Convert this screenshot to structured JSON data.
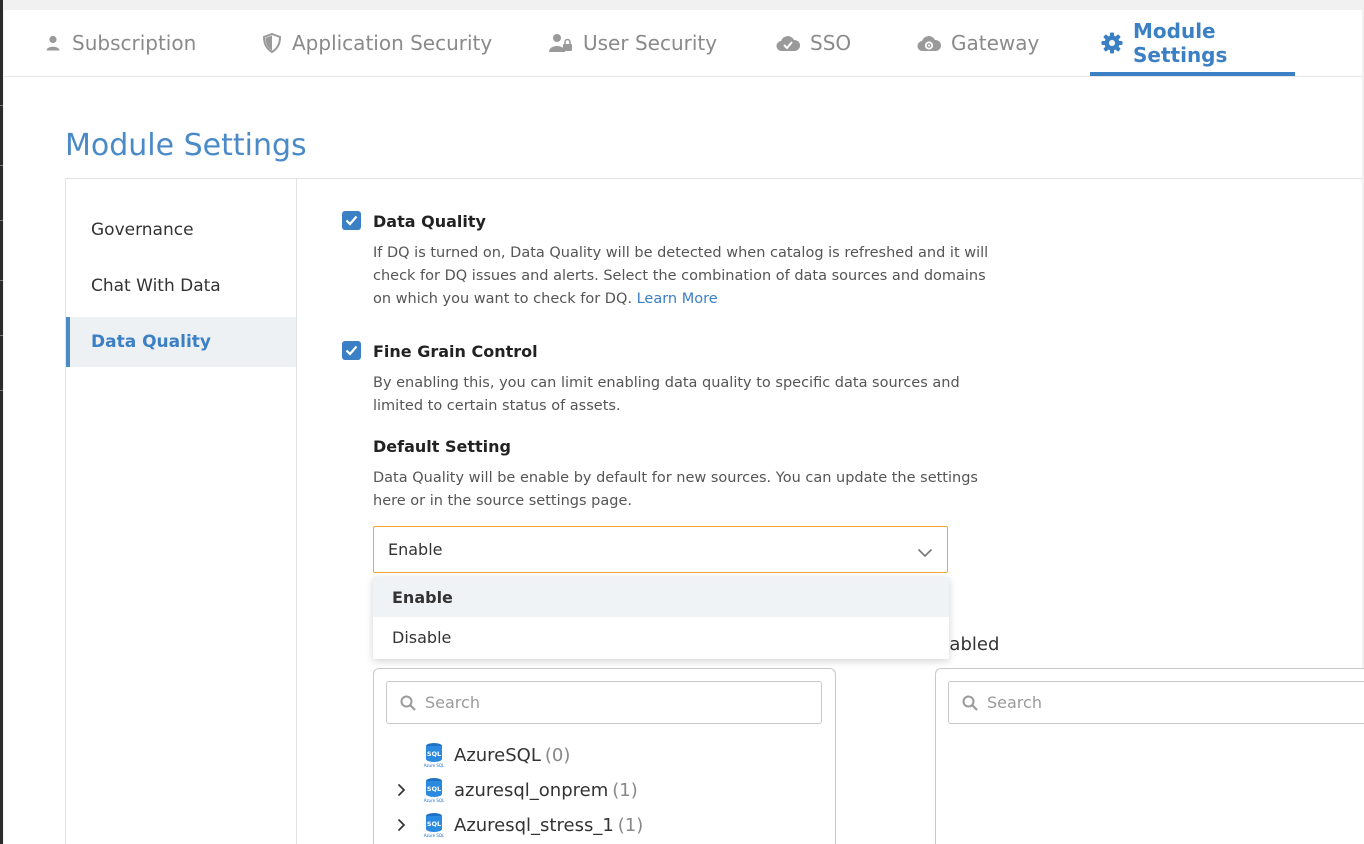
{
  "nav": {
    "tabs": [
      {
        "label": "Subscription",
        "icon": "user-icon"
      },
      {
        "label": "Application Security",
        "icon": "shield-icon"
      },
      {
        "label": "User Security",
        "icon": "user-lock-icon"
      },
      {
        "label": "SSO",
        "icon": "cloud-check-icon"
      },
      {
        "label": "Gateway",
        "icon": "cloud-gear-icon"
      },
      {
        "label": "Module Settings",
        "icon": "gear-icon",
        "active": true
      }
    ]
  },
  "page": {
    "title": "Module Settings"
  },
  "sidebar": {
    "items": [
      {
        "label": "Governance"
      },
      {
        "label": "Chat With Data"
      },
      {
        "label": "Data Quality",
        "active": true
      }
    ]
  },
  "data_quality": {
    "title": "Data Quality",
    "checked": true,
    "description": "If DQ is turned on, Data Quality will be detected when catalog is refreshed and it will check for DQ issues and alerts. Select the combination of data sources and domains on which you want to check for DQ.",
    "learn_more": "Learn More"
  },
  "fine_grain": {
    "title": "Fine Grain Control",
    "checked": true,
    "description": "By enabling this, you can limit enabling data quality to specific data sources and limited to certain status of assets."
  },
  "default_setting": {
    "title": "Default Setting",
    "description": "Data Quality will be enable by default for new sources. You can update the settings here or in the source settings page.",
    "selected": "Enable",
    "options": [
      "Enable",
      "Disable"
    ]
  },
  "enabled_label_partial": "nabled",
  "left_list": {
    "search_placeholder": "Search",
    "items": [
      {
        "name": "AzureSQL",
        "count": "(0)",
        "expandable": false
      },
      {
        "name": "azuresql_onprem",
        "count": "(1)",
        "expandable": true
      },
      {
        "name": "Azuresql_stress_1",
        "count": "(1)",
        "expandable": true
      }
    ],
    "icon_text": "SQL",
    "icon_caption": "Azure SQL"
  },
  "right_list": {
    "search_placeholder": "Search"
  },
  "colors": {
    "accent": "#3b7fc4",
    "title": "#4a8ac6",
    "select_border": "#f0a830"
  }
}
